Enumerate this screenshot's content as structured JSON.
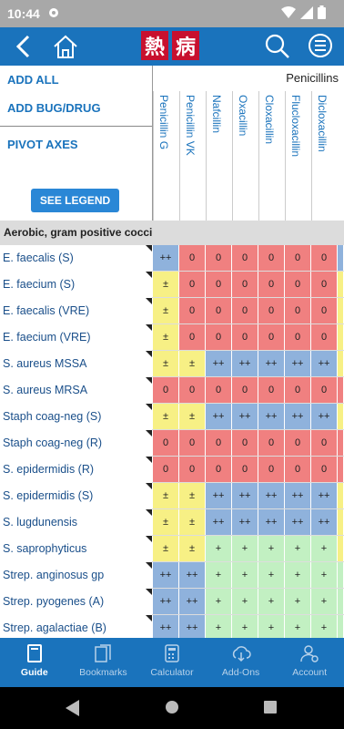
{
  "status": {
    "time": "10:44"
  },
  "app": {
    "logo_chars": [
      "熱",
      "病"
    ]
  },
  "left_panel": {
    "add_all": "ADD ALL",
    "add_bug_drug": "ADD BUG/DRUG",
    "pivot_axes": "PIVOT AXES",
    "see_legend": "SEE LEGEND"
  },
  "drug_class": "Penicillins",
  "drugs": [
    "Penicillin G",
    "Penicillin VK",
    "Nafcillin",
    "Oxacillin",
    "Cloxacillin",
    "Flucloxacillin",
    "Dicloxacillin"
  ],
  "section": "Aerobic, gram positive cocci",
  "colors": {
    "green": "#c2f0c2",
    "blue": "#8fb2dc",
    "red": "#f08080",
    "yellow": "#f7f085"
  },
  "rows": [
    {
      "bug": "E. faecalis (S)",
      "cells": [
        [
          "++",
          "blue"
        ],
        [
          "0",
          "red"
        ],
        [
          "0",
          "red"
        ],
        [
          "0",
          "red"
        ],
        [
          "0",
          "red"
        ],
        [
          "0",
          "red"
        ],
        [
          "0",
          "red"
        ]
      ],
      "edge": "blue"
    },
    {
      "bug": "E. faecium (S)",
      "cells": [
        [
          "±",
          "yellow"
        ],
        [
          "0",
          "red"
        ],
        [
          "0",
          "red"
        ],
        [
          "0",
          "red"
        ],
        [
          "0",
          "red"
        ],
        [
          "0",
          "red"
        ],
        [
          "0",
          "red"
        ]
      ],
      "edge": "yellow"
    },
    {
      "bug": "E. faecalis (VRE)",
      "cells": [
        [
          "±",
          "yellow"
        ],
        [
          "0",
          "red"
        ],
        [
          "0",
          "red"
        ],
        [
          "0",
          "red"
        ],
        [
          "0",
          "red"
        ],
        [
          "0",
          "red"
        ],
        [
          "0",
          "red"
        ]
      ],
      "edge": "yellow"
    },
    {
      "bug": "E. faecium (VRE)",
      "cells": [
        [
          "±",
          "yellow"
        ],
        [
          "0",
          "red"
        ],
        [
          "0",
          "red"
        ],
        [
          "0",
          "red"
        ],
        [
          "0",
          "red"
        ],
        [
          "0",
          "red"
        ],
        [
          "0",
          "red"
        ]
      ],
      "edge": "yellow"
    },
    {
      "bug": "S. aureus MSSA",
      "cells": [
        [
          "±",
          "yellow"
        ],
        [
          "±",
          "yellow"
        ],
        [
          "++",
          "blue"
        ],
        [
          "++",
          "blue"
        ],
        [
          "++",
          "blue"
        ],
        [
          "++",
          "blue"
        ],
        [
          "++",
          "blue"
        ]
      ],
      "edge": "yellow"
    },
    {
      "bug": "S. aureus MRSA",
      "cells": [
        [
          "0",
          "red"
        ],
        [
          "0",
          "red"
        ],
        [
          "0",
          "red"
        ],
        [
          "0",
          "red"
        ],
        [
          "0",
          "red"
        ],
        [
          "0",
          "red"
        ],
        [
          "0",
          "red"
        ]
      ],
      "edge": "red"
    },
    {
      "bug": "Staph coag-neg (S)",
      "cells": [
        [
          "±",
          "yellow"
        ],
        [
          "±",
          "yellow"
        ],
        [
          "++",
          "blue"
        ],
        [
          "++",
          "blue"
        ],
        [
          "++",
          "blue"
        ],
        [
          "++",
          "blue"
        ],
        [
          "++",
          "blue"
        ]
      ],
      "edge": "yellow"
    },
    {
      "bug": "Staph coag-neg (R)",
      "cells": [
        [
          "0",
          "red"
        ],
        [
          "0",
          "red"
        ],
        [
          "0",
          "red"
        ],
        [
          "0",
          "red"
        ],
        [
          "0",
          "red"
        ],
        [
          "0",
          "red"
        ],
        [
          "0",
          "red"
        ]
      ],
      "edge": "red"
    },
    {
      "bug": "S. epidermidis (R)",
      "cells": [
        [
          "0",
          "red"
        ],
        [
          "0",
          "red"
        ],
        [
          "0",
          "red"
        ],
        [
          "0",
          "red"
        ],
        [
          "0",
          "red"
        ],
        [
          "0",
          "red"
        ],
        [
          "0",
          "red"
        ]
      ],
      "edge": "red"
    },
    {
      "bug": "S. epidermidis (S)",
      "cells": [
        [
          "±",
          "yellow"
        ],
        [
          "±",
          "yellow"
        ],
        [
          "++",
          "blue"
        ],
        [
          "++",
          "blue"
        ],
        [
          "++",
          "blue"
        ],
        [
          "++",
          "blue"
        ],
        [
          "++",
          "blue"
        ]
      ],
      "edge": "yellow"
    },
    {
      "bug": "S. lugdunensis",
      "cells": [
        [
          "±",
          "yellow"
        ],
        [
          "±",
          "yellow"
        ],
        [
          "++",
          "blue"
        ],
        [
          "++",
          "blue"
        ],
        [
          "++",
          "blue"
        ],
        [
          "++",
          "blue"
        ],
        [
          "++",
          "blue"
        ]
      ],
      "edge": "yellow"
    },
    {
      "bug": "S. saprophyticus",
      "cells": [
        [
          "±",
          "yellow"
        ],
        [
          "±",
          "yellow"
        ],
        [
          "+",
          "green"
        ],
        [
          "+",
          "green"
        ],
        [
          "+",
          "green"
        ],
        [
          "+",
          "green"
        ],
        [
          "+",
          "green"
        ]
      ],
      "edge": "yellow"
    },
    {
      "bug": "Strep. anginosus gp",
      "cells": [
        [
          "++",
          "blue"
        ],
        [
          "++",
          "blue"
        ],
        [
          "+",
          "green"
        ],
        [
          "+",
          "green"
        ],
        [
          "+",
          "green"
        ],
        [
          "+",
          "green"
        ],
        [
          "+",
          "green"
        ]
      ],
      "edge": "green"
    },
    {
      "bug": "Strep. pyogenes (A)",
      "cells": [
        [
          "++",
          "blue"
        ],
        [
          "++",
          "blue"
        ],
        [
          "+",
          "green"
        ],
        [
          "+",
          "green"
        ],
        [
          "+",
          "green"
        ],
        [
          "+",
          "green"
        ],
        [
          "+",
          "green"
        ]
      ],
      "edge": "green"
    },
    {
      "bug": "Strep. agalactiae (B)",
      "cells": [
        [
          "++",
          "blue"
        ],
        [
          "++",
          "blue"
        ],
        [
          "+",
          "green"
        ],
        [
          "+",
          "green"
        ],
        [
          "+",
          "green"
        ],
        [
          "+",
          "green"
        ],
        [
          "+",
          "green"
        ]
      ],
      "edge": "green"
    }
  ],
  "nav": [
    {
      "label": "Guide",
      "icon": "book-icon",
      "active": true
    },
    {
      "label": "Bookmarks",
      "icon": "bookmarks-icon",
      "active": false
    },
    {
      "label": "Calculator",
      "icon": "calculator-icon",
      "active": false
    },
    {
      "label": "Add-Ons",
      "icon": "download-icon",
      "active": false
    },
    {
      "label": "Account",
      "icon": "account-icon",
      "active": false
    }
  ]
}
